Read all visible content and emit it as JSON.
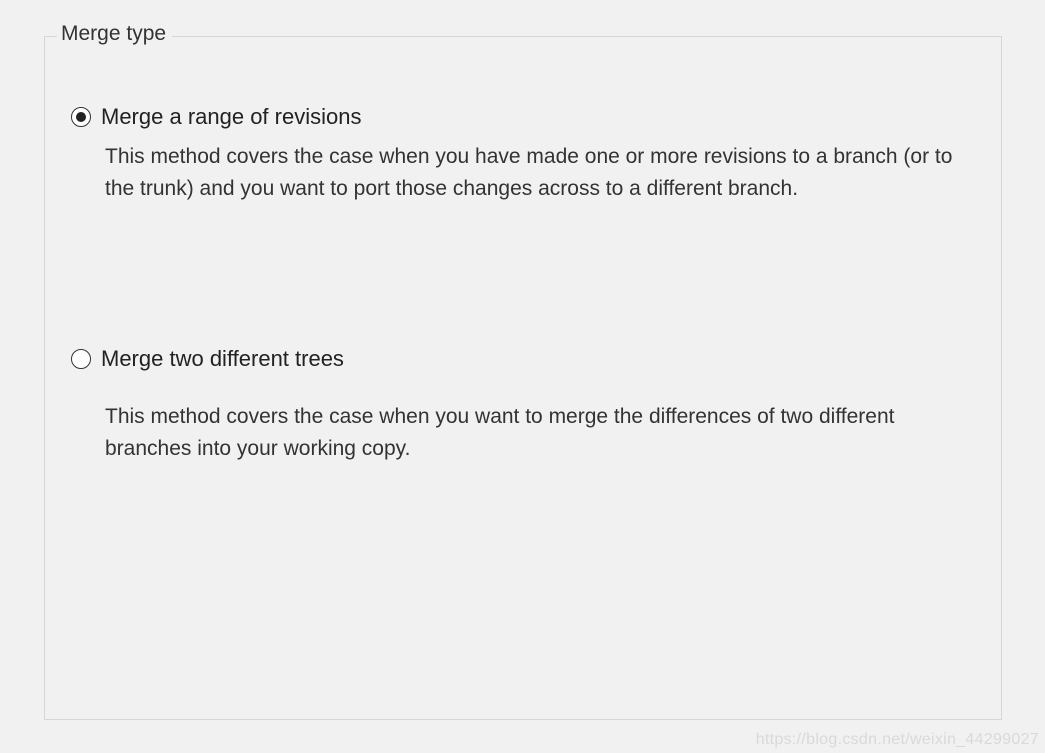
{
  "group": {
    "title": "Merge type"
  },
  "options": [
    {
      "label": "Merge a range of revisions",
      "description": "This method covers the case when you have made one or more revisions to a branch (or to the trunk) and you want to port those changes across to a different branch.",
      "checked": true
    },
    {
      "label": "Merge two different trees",
      "description": "This method covers the case when you want to merge the differences of two different branches into your working copy.",
      "checked": false
    }
  ],
  "watermark": "https://blog.csdn.net/weixin_44299027"
}
